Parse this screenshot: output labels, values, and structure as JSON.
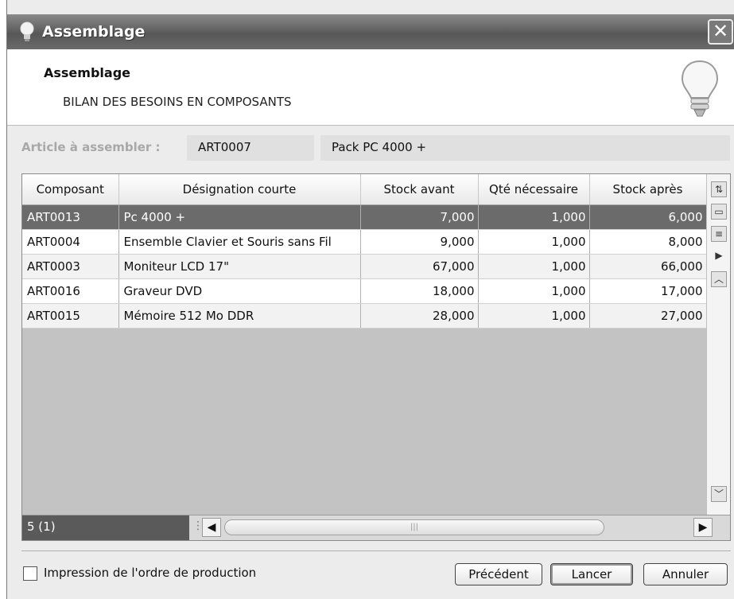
{
  "window": {
    "title": "Assemblage",
    "close_label": "✕"
  },
  "header": {
    "title": "Assemblage",
    "subtitle": "BILAN DES BESOINS EN COMPOSANTS"
  },
  "article": {
    "label": "Article à assembler :",
    "code": "ART0007",
    "name": "Pack PC 4000 +"
  },
  "grid": {
    "columns": [
      "Composant",
      "Désignation courte",
      "Stock avant",
      "Qté nécessaire",
      "Stock après"
    ],
    "rows": [
      {
        "code": "ART0013",
        "designation": "Pc 4000 +",
        "stock_avant": "7,000",
        "qte": "1,000",
        "stock_apres": "6,000",
        "selected": true
      },
      {
        "code": "ART0004",
        "designation": "Ensemble Clavier et Souris sans Fil",
        "stock_avant": "9,000",
        "qte": "1,000",
        "stock_apres": "8,000"
      },
      {
        "code": "ART0003",
        "designation": "Moniteur LCD 17\"",
        "stock_avant": "67,000",
        "qte": "1,000",
        "stock_apres": "66,000"
      },
      {
        "code": "ART0016",
        "designation": "Graveur DVD",
        "stock_avant": "18,000",
        "qte": "1,000",
        "stock_apres": "17,000"
      },
      {
        "code": "ART0015",
        "designation": "Mémoire 512 Mo DDR",
        "stock_avant": "28,000",
        "qte": "1,000",
        "stock_apres": "27,000"
      }
    ],
    "count": "5 (1)"
  },
  "options": {
    "print_order_label": "Impression de l'ordre de production",
    "print_order_checked": false
  },
  "buttons": {
    "previous": "Précédent",
    "run": "Lancer",
    "cancel": "Annuler"
  },
  "colors": {
    "titlebar": "#626262",
    "selected_row": "#6b6b6b",
    "footer_count": "#5a5a5a"
  }
}
